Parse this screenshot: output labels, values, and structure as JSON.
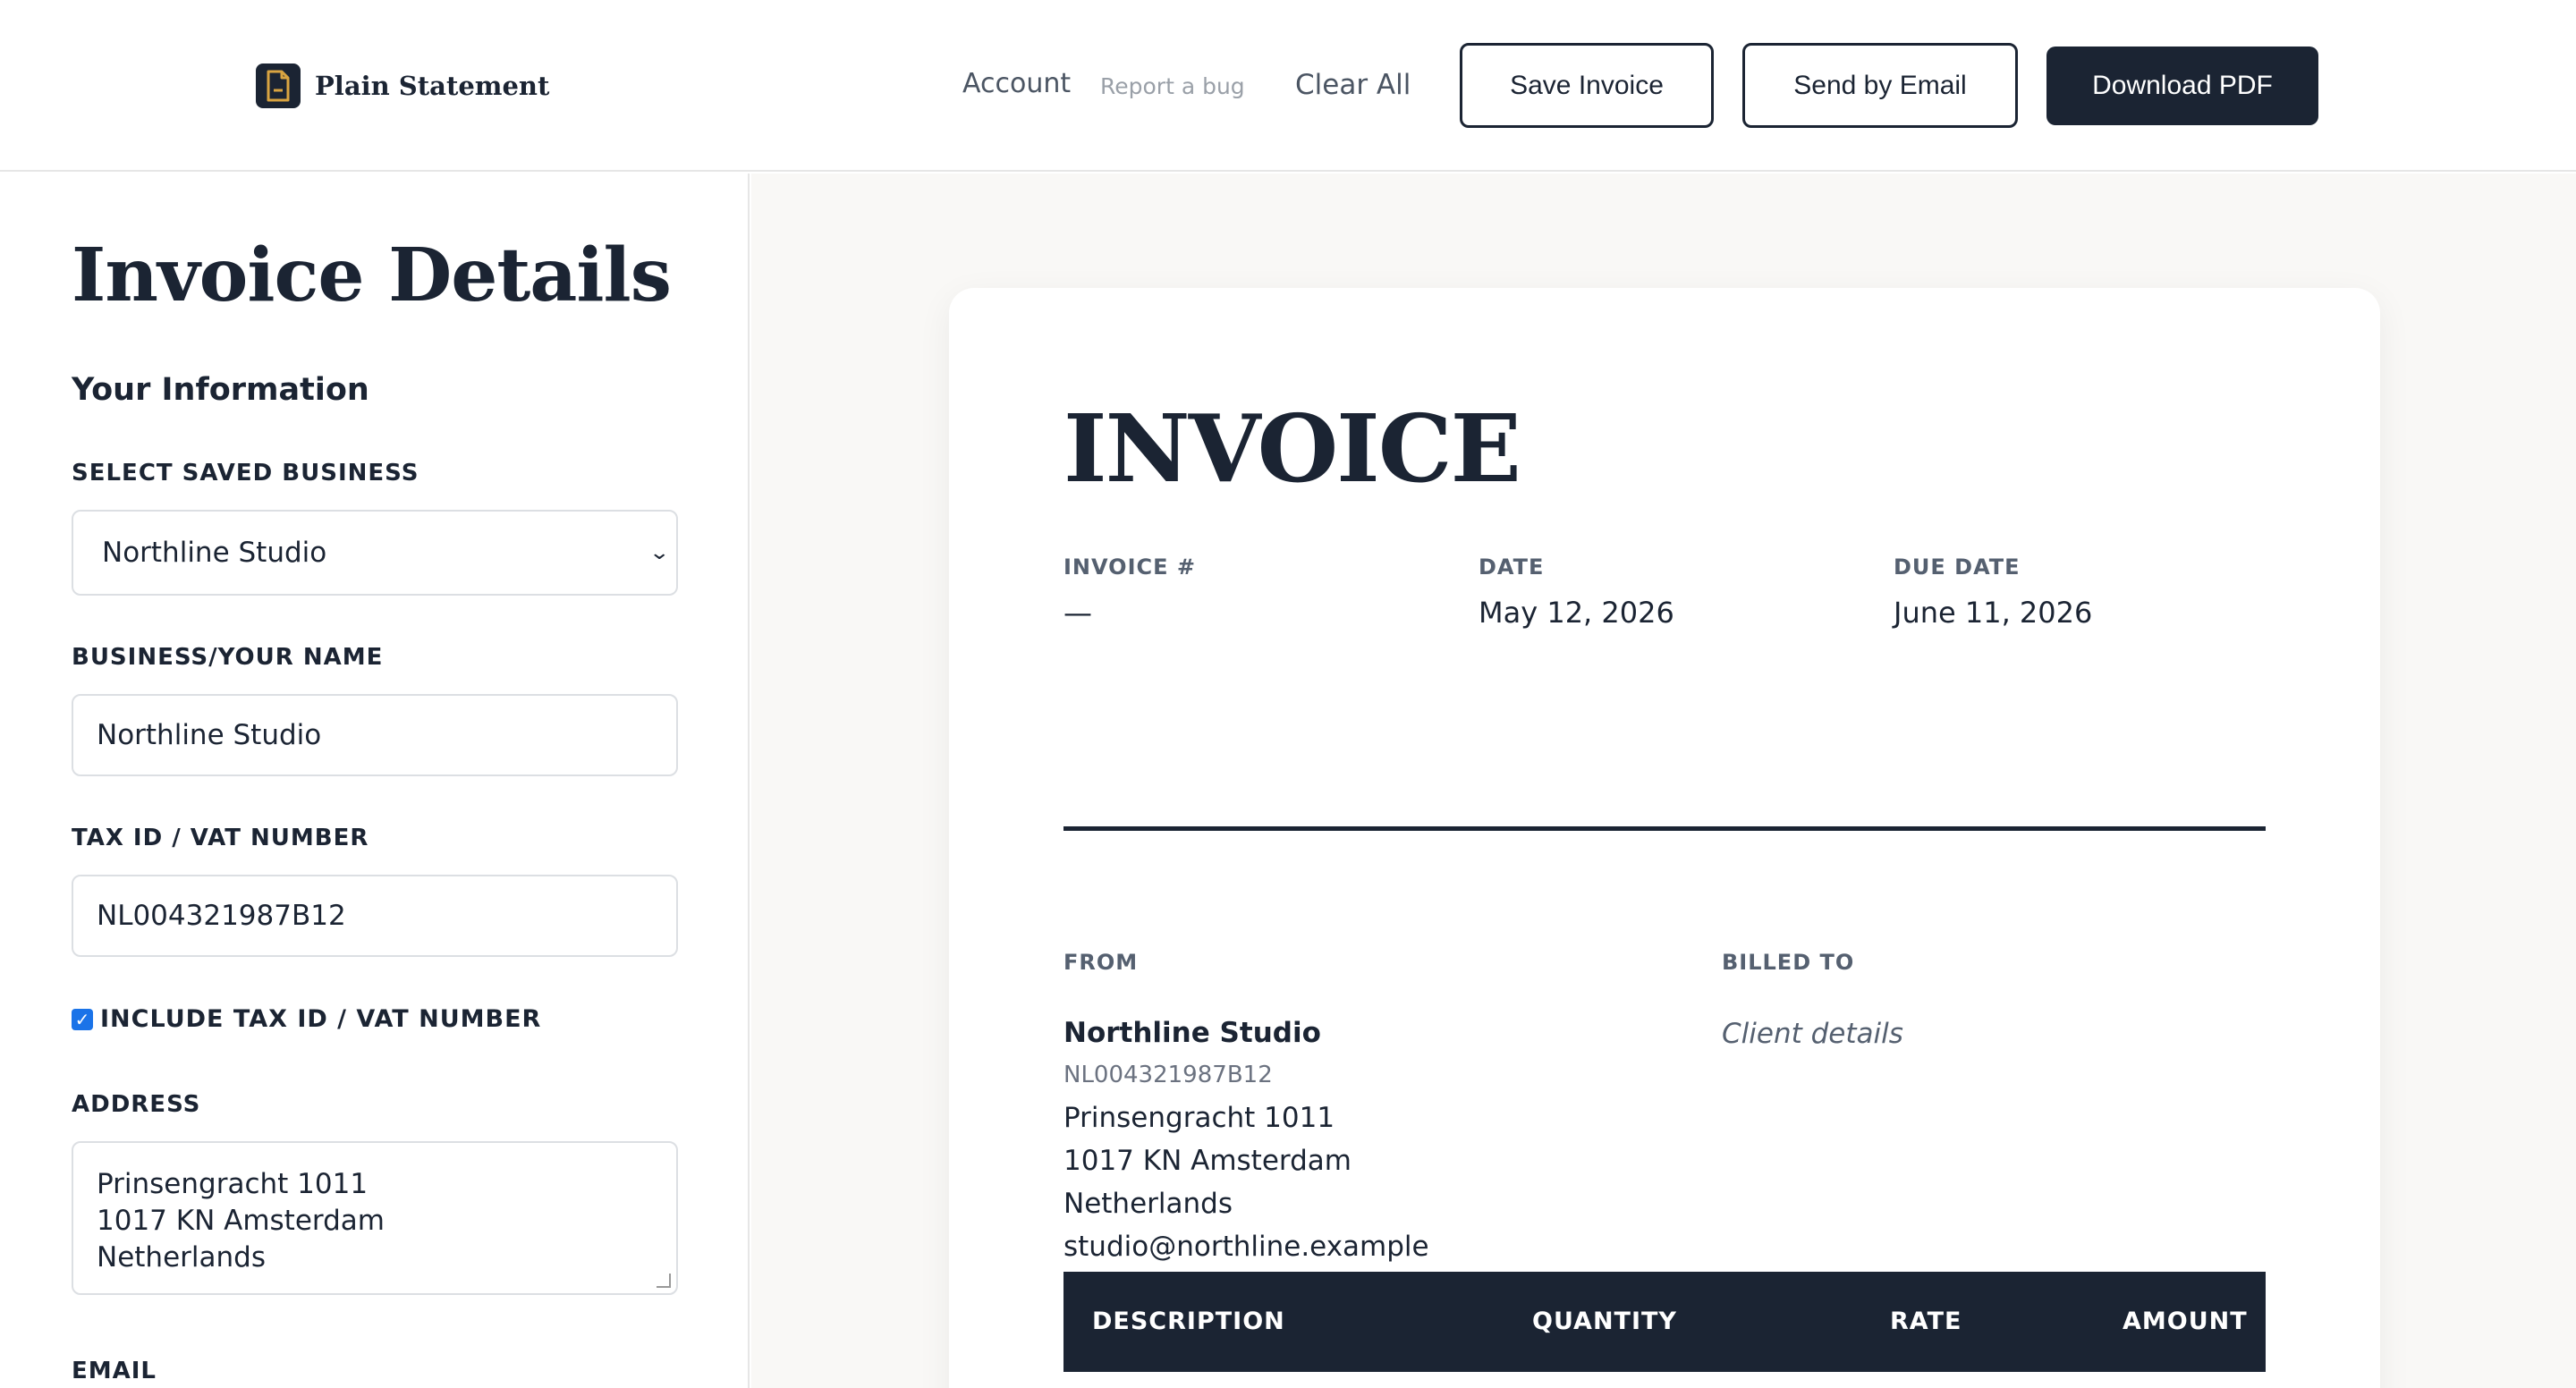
{
  "header": {
    "logo_text": "Plain Statement",
    "nav": {
      "account": "Account",
      "report_bug": "Report a bug",
      "clear_all": "Clear All"
    },
    "buttons": {
      "save": "Save Invoice",
      "send": "Send by Email",
      "download": "Download PDF"
    }
  },
  "form": {
    "title": "Invoice Details",
    "section_title": "Your Information",
    "saved_business": {
      "label": "SELECT SAVED BUSINESS",
      "value": "Northline Studio"
    },
    "business_name": {
      "label": "BUSINESS/YOUR NAME",
      "value": "Northline Studio"
    },
    "tax_id": {
      "label": "TAX ID / VAT NUMBER",
      "value": "NL004321987B12"
    },
    "include_tax": {
      "label": "INCLUDE TAX ID / VAT NUMBER",
      "checked": true
    },
    "address": {
      "label": "ADDRESS",
      "lines": [
        "Prinsengracht 1011",
        "1017 KN Amsterdam",
        "Netherlands"
      ]
    },
    "email": {
      "label": "EMAIL"
    }
  },
  "invoice": {
    "title": "INVOICE",
    "meta": {
      "number_label": "INVOICE #",
      "number_value": "—",
      "date_label": "DATE",
      "date_value": "May 12, 2026",
      "due_label": "DUE DATE",
      "due_value": "June 11, 2026"
    },
    "from": {
      "label": "FROM",
      "name": "Northline Studio",
      "tax_id": "NL004321987B12",
      "lines": [
        "Prinsengracht 1011",
        "1017 KN Amsterdam",
        "Netherlands",
        "studio@northline.example"
      ]
    },
    "billed_to": {
      "label": "BILLED TO",
      "placeholder": "Client details"
    },
    "table": {
      "columns": [
        "DESCRIPTION",
        "QUANTITY",
        "RATE",
        "AMOUNT"
      ]
    }
  },
  "colors": {
    "primary": "#1b2433",
    "muted": "#556070",
    "preview_bg": "#f9f8f6",
    "checkbox": "#1a73e8"
  }
}
